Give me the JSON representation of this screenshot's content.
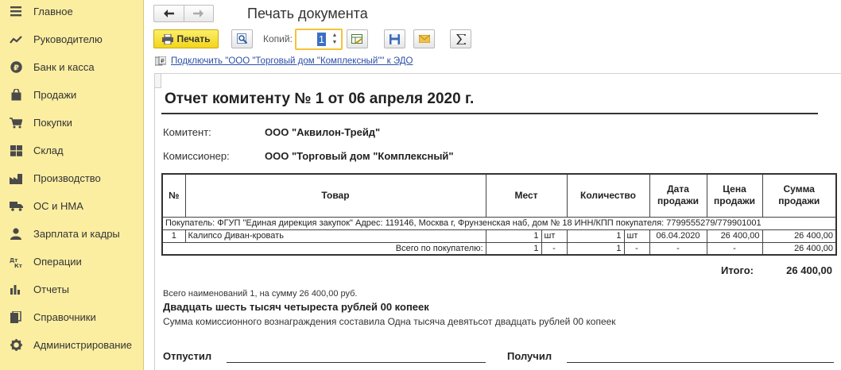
{
  "sidebar": {
    "items": [
      {
        "label": "Главное",
        "icon": "menu-icon"
      },
      {
        "label": "Руководителю",
        "icon": "trend-icon"
      },
      {
        "label": "Банк и касса",
        "icon": "ruble-icon"
      },
      {
        "label": "Продажи",
        "icon": "bag-icon"
      },
      {
        "label": "Покупки",
        "icon": "cart-icon"
      },
      {
        "label": "Склад",
        "icon": "warehouse-icon"
      },
      {
        "label": "Производство",
        "icon": "factory-icon"
      },
      {
        "label": "ОС и НМА",
        "icon": "truck-icon"
      },
      {
        "label": "Зарплата и кадры",
        "icon": "person-icon"
      },
      {
        "label": "Операции",
        "icon": "debit-credit-icon"
      },
      {
        "label": "Отчеты",
        "icon": "bar-chart-icon"
      },
      {
        "label": "Справочники",
        "icon": "books-icon"
      },
      {
        "label": "Администрирование",
        "icon": "gear-icon"
      }
    ]
  },
  "header": {
    "title": "Печать документа"
  },
  "toolbar": {
    "print_label": "Печать",
    "copies_label": "Копий:",
    "copies_value": "1"
  },
  "edo_link": "Подключить \"ООО \"Торговый дом \"Комплексный\"\" к ЭДО",
  "report": {
    "title": "Отчет комитенту № 1 от 06 апреля 2020 г.",
    "principal_label": "Комитент:",
    "principal_value": "ООО \"Аквилон-Трейд\"",
    "agent_label": "Комиссионер:",
    "agent_value": "ООО \"Торговый дом \"Комплексный\"",
    "columns": [
      "№",
      "Товар",
      "Мест",
      "Количество",
      "Дата продажи",
      "Цена продажи",
      "Сумма продажи"
    ],
    "buyer_row": "Покупатель: ФГУП \"Единая дирекция закупок\" Адрес: 119146, Москва г, Фрунзенская наб, дом № 18 ИНН/КПП покупателя: 7799555279/779901001",
    "row": {
      "num": "1",
      "product": "Калипсо Диван-кровать",
      "places": "1",
      "places_unit": "шт",
      "qty": "1",
      "qty_unit": "шт",
      "date": "06.04.2020",
      "price": "26 400,00",
      "sum": "26 400,00"
    },
    "subtotal": {
      "label": "Всего по покупателю:",
      "places": "1",
      "places_unit": "-",
      "qty": "1",
      "qty_unit": "-",
      "date": "-",
      "price": "-",
      "sum": "26 400,00"
    },
    "total_label": "Итого:",
    "total_value": "26 400,00",
    "items_summary": "Всего наименований 1, на сумму 26 400,00 руб.",
    "sum_in_words": "Двадцать шесть тысяч четыреста рублей 00 копеек",
    "commission_text": "Сумма комиссионного вознаграждения составила Одна тысяча девятьсот двадцать рублей 00 копеек",
    "released_label": "Отпустил",
    "received_label": "Получил"
  }
}
